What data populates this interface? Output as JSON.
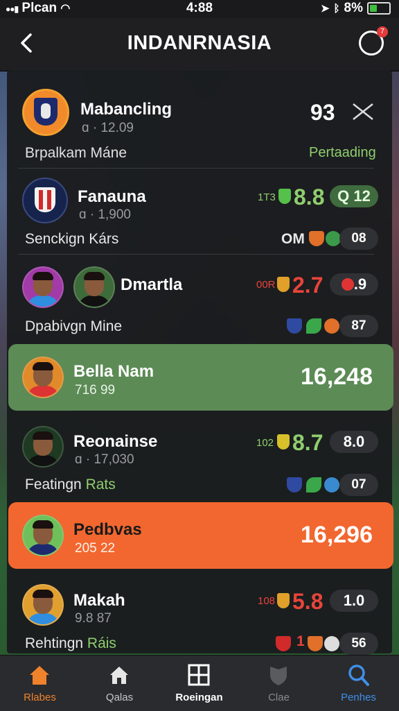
{
  "status_bar": {
    "carrier": "Plcan",
    "time": "4:88",
    "battery": "8%"
  },
  "header": {
    "title": "INDANRNASIA",
    "notification_count": "7"
  },
  "rows": [
    {
      "name": "Mabancling",
      "sub": "ɑ · 12.09",
      "label": "Brpalkam Máne",
      "value": "93",
      "status": "Pertaading"
    },
    {
      "name": "Fanauna",
      "sub": "ɑ · 1,900",
      "label": "Senckign Kárs",
      "small": "1T3",
      "value": "8.8",
      "pill": "Q 12",
      "extra_prefix": "OM",
      "extra_value": "08"
    },
    {
      "name": "Dmartla",
      "label": "Dpabivgn Mine",
      "small": "00R",
      "value": "2.7",
      "pill": ".9",
      "extra_value": "87"
    },
    {
      "name": "Bella Nam",
      "sub": "716 99",
      "value": "16,248"
    },
    {
      "name": "Reonainse",
      "sub": "ɑ · 17,030",
      "label_plain": "Featingn",
      "label_accent": "Rats",
      "small": "102",
      "value": "8.7",
      "pill": "8.0",
      "extra_value": "07"
    },
    {
      "name": "Pedbvas",
      "sub": "205 22",
      "value": "16,296"
    },
    {
      "name": "Makah",
      "sub": "9.8 87",
      "label_plain": "Rehtingn",
      "label_accent": "Ráis",
      "small": "108",
      "value": "5.8",
      "pill": "1.0",
      "extra_prefix": "1",
      "extra_value": "56"
    }
  ],
  "nav": [
    {
      "label": "Rlabes",
      "icon": "home-icon",
      "color": "#f0822c"
    },
    {
      "label": "Qalas",
      "icon": "house-outline-icon",
      "color": "#c8c8c8"
    },
    {
      "label": "Roeingan",
      "icon": "grid-icon",
      "color": "#ffffff"
    },
    {
      "label": "Clae",
      "icon": "shield-icon",
      "color": "#8a8a8a"
    },
    {
      "label": "Penhes",
      "icon": "search-icon",
      "color": "#3f8fe8"
    }
  ],
  "colors": {
    "green_accent": "#8fce6e",
    "red_accent": "#e8443a",
    "orange_card": "#f2672f",
    "green_card": "#5c8b56"
  }
}
